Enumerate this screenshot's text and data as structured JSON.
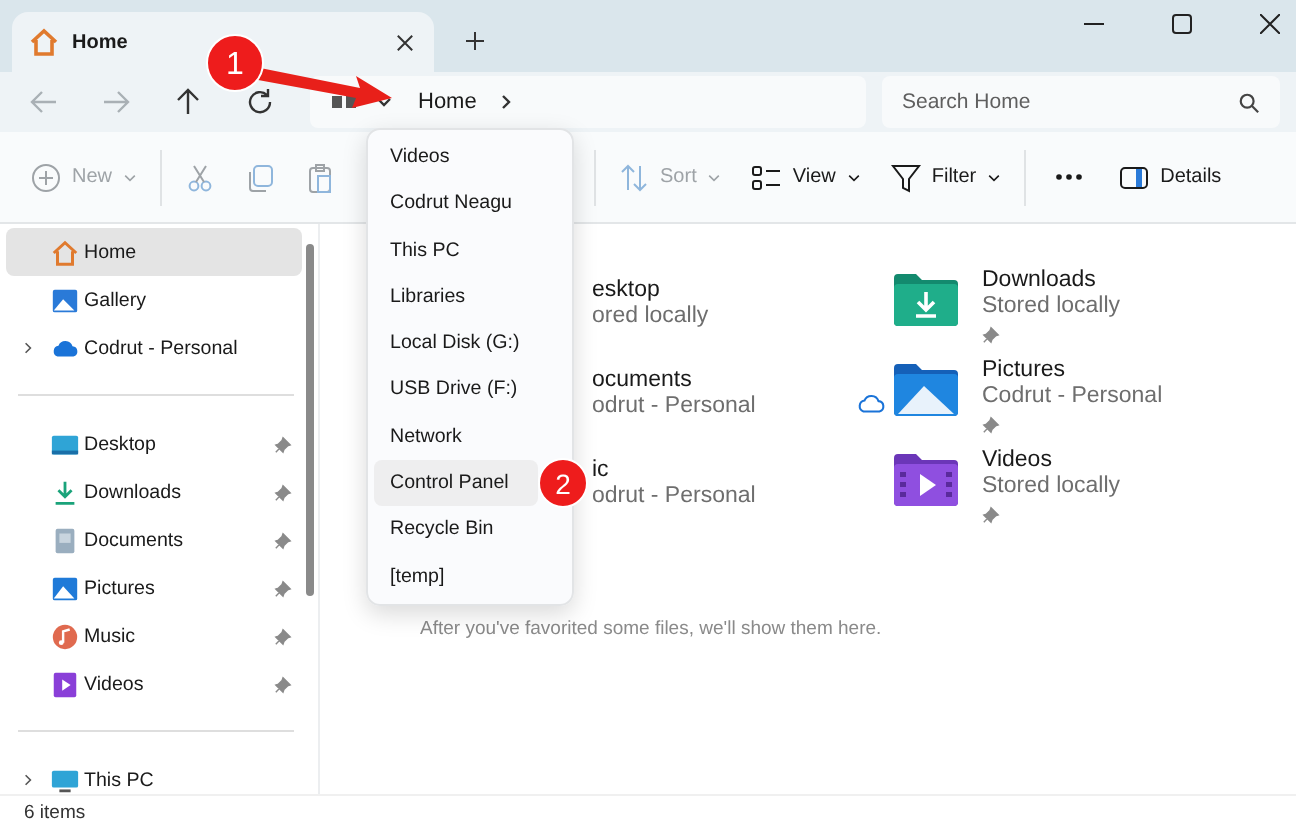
{
  "window": {
    "tab": {
      "title": "Home"
    }
  },
  "navigation": [
    {
      "kind": "back",
      "disabled": true
    },
    {
      "kind": "forward",
      "disabled": true
    },
    {
      "kind": "up",
      "disabled": false
    },
    {
      "kind": "refresh",
      "disabled": false
    }
  ],
  "address_bar": {
    "path": [
      "Home"
    ]
  },
  "search": {
    "placeholder": "Search Home"
  },
  "toolbar": [
    {
      "kind": "new",
      "label": "New",
      "disabled": true
    },
    {
      "kind": "cut",
      "disabled": true
    },
    {
      "kind": "copy",
      "disabled": true
    },
    {
      "kind": "paste",
      "disabled": true
    },
    {
      "kind": "sort",
      "label": "Sort",
      "disabled": true
    },
    {
      "kind": "view",
      "label": "View",
      "disabled": false
    },
    {
      "kind": "filter",
      "label": "Filter",
      "disabled": false
    },
    {
      "kind": "more",
      "disabled": false
    },
    {
      "kind": "details",
      "label": "Details",
      "disabled": false
    }
  ],
  "sidebar": {
    "sections": [
      {
        "items": [
          {
            "kind": "home",
            "label": "Home",
            "selected": true,
            "pinned": false,
            "expandable": false
          },
          {
            "kind": "gallery",
            "label": "Gallery",
            "selected": false,
            "pinned": false,
            "expandable": false
          },
          {
            "kind": "cloud",
            "label": "Codrut - Personal",
            "selected": false,
            "pinned": false,
            "expandable": true
          }
        ]
      },
      {
        "items": [
          {
            "kind": "desktop",
            "label": "Desktop",
            "selected": false,
            "pinned": true,
            "expandable": false
          },
          {
            "kind": "downloads",
            "label": "Downloads",
            "selected": false,
            "pinned": true,
            "expandable": false
          },
          {
            "kind": "documents",
            "label": "Documents",
            "selected": false,
            "pinned": true,
            "expandable": false
          },
          {
            "kind": "pictures",
            "label": "Pictures",
            "selected": false,
            "pinned": true,
            "expandable": false
          },
          {
            "kind": "music",
            "label": "Music",
            "selected": false,
            "pinned": true,
            "expandable": false
          },
          {
            "kind": "videos",
            "label": "Videos",
            "selected": false,
            "pinned": true,
            "expandable": false
          }
        ]
      },
      {
        "items": [
          {
            "kind": "pc",
            "label": "This PC",
            "selected": false,
            "pinned": false,
            "expandable": true
          }
        ]
      }
    ]
  },
  "quick_access": {
    "column_1": [
      {
        "name": "esktop",
        "detail": "ored locally",
        "cloud": false
      },
      {
        "name": "ocuments",
        "detail": "odrut - Personal",
        "cloud": true
      },
      {
        "name": "ic",
        "detail": "odrut - Personal",
        "cloud": false
      }
    ],
    "column_2": [
      {
        "kind": "downloads",
        "name": "Downloads",
        "detail": "Stored locally",
        "pinned": true
      },
      {
        "kind": "pictures",
        "name": "Pictures",
        "detail": "Codrut - Personal",
        "pinned": true
      },
      {
        "kind": "videos",
        "name": "Videos",
        "detail": "Stored locally",
        "pinned": true
      }
    ]
  },
  "empty_message": "After you've favorited some files, we'll show them here.",
  "history_menu": {
    "items": [
      {
        "label": "Videos",
        "selected": false
      },
      {
        "label": "Codrut Neagu",
        "selected": false
      },
      {
        "label": "This PC",
        "selected": false
      },
      {
        "label": "Libraries",
        "selected": false
      },
      {
        "label": "Local Disk (G:)",
        "selected": false
      },
      {
        "label": "USB Drive (F:)",
        "selected": false
      },
      {
        "label": "Network",
        "selected": false
      },
      {
        "label": "Control Panel",
        "selected": true
      },
      {
        "label": "Recycle Bin",
        "selected": false
      },
      {
        "label": "[temp]",
        "selected": false
      }
    ]
  },
  "annotations": [
    {
      "label": "1"
    },
    {
      "label": "2"
    }
  ],
  "status_bar": {
    "count": "6 items"
  }
}
